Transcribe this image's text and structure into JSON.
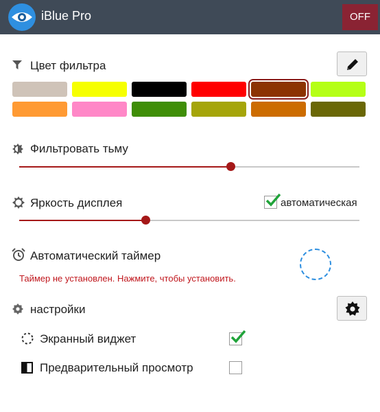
{
  "app": {
    "title": "iBlue Pro",
    "power_button": "OFF"
  },
  "filter_color": {
    "title": "Цвет фильтра",
    "swatches": [
      {
        "color": "#cfc3b8"
      },
      {
        "color": "#f6ff00"
      },
      {
        "color": "#000000"
      },
      {
        "color": "#ff0000"
      },
      {
        "color": "#8c3303",
        "selected": true
      },
      {
        "color": "#b5ff16"
      },
      {
        "color": "#ff9a33"
      },
      {
        "color": "#ff87c7"
      },
      {
        "color": "#3f8e07"
      },
      {
        "color": "#a5a50a"
      },
      {
        "color": "#cc6c00"
      },
      {
        "color": "#6a6706"
      }
    ]
  },
  "dim_filter": {
    "title": "Фильтровать тьму",
    "level_percent": 62
  },
  "brightness": {
    "title": "Яркость дисплея",
    "auto_label": "автоматическая",
    "auto_checked": true,
    "level_percent": 37
  },
  "timer": {
    "title": "Автоматический таймер",
    "message": "Таймер не установлен. Нажмите, чтобы установить."
  },
  "settings": {
    "title": "настройки",
    "options": [
      {
        "label": "Экранный виджет",
        "checked": true
      },
      {
        "label": "Предварительный просмотр",
        "checked": false
      }
    ]
  },
  "colors": {
    "header_bg": "#3f4a57",
    "accent": "#a51818",
    "off_button": "#8a2333",
    "check": "#20a33a",
    "timer_ring": "#2e8fe0"
  }
}
